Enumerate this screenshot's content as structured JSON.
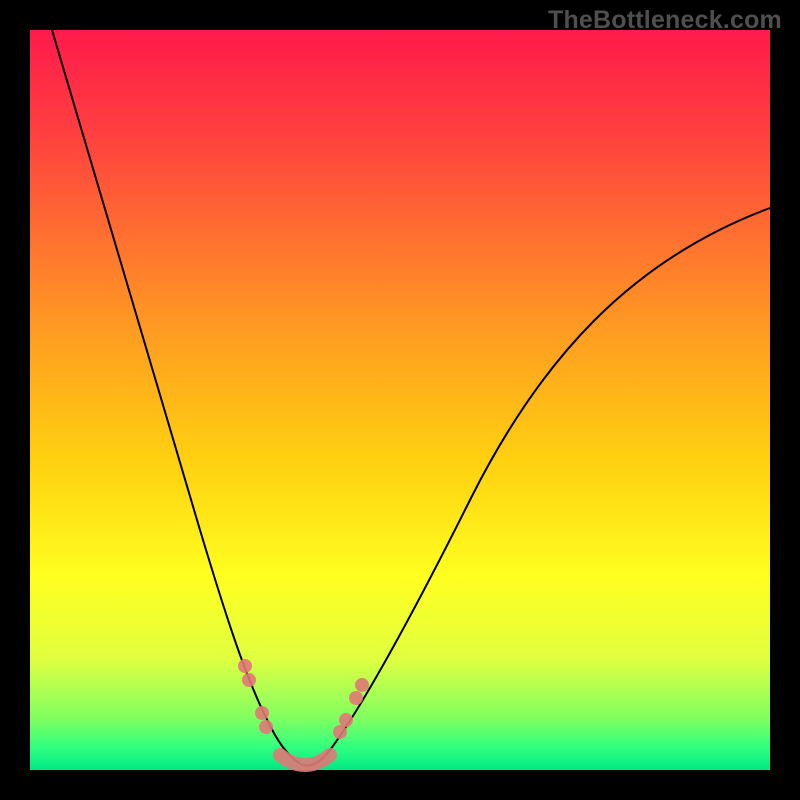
{
  "watermark": "TheBottleneck.com",
  "chart_data": {
    "type": "line",
    "title": "",
    "xlabel": "",
    "ylabel": "",
    "xlim": [
      0,
      100
    ],
    "ylim": [
      0,
      100
    ],
    "grid": false,
    "legend": false,
    "series": [
      {
        "name": "bottleneck-curve",
        "x": [
          3,
          5,
          8,
          12,
          16,
          20,
          24,
          27,
          29,
          31,
          33,
          35,
          37,
          40,
          44,
          50,
          56,
          62,
          70,
          78,
          86,
          94,
          100
        ],
        "y": [
          100,
          90,
          80,
          68,
          56,
          44,
          32,
          22,
          14,
          8,
          4,
          1,
          1,
          3,
          8,
          16,
          26,
          36,
          48,
          58,
          66,
          72,
          76
        ]
      }
    ],
    "annotations": [
      {
        "name": "optimal-zone-markers",
        "points_x": [
          28.5,
          30,
          33,
          36,
          39,
          41,
          42.5
        ],
        "points_y": [
          16,
          10,
          2,
          0.5,
          2,
          10,
          16
        ]
      }
    ],
    "background_gradient": {
      "top": "#ff1a4b",
      "mid": "#ffff20",
      "bottom": "#00e884"
    }
  }
}
